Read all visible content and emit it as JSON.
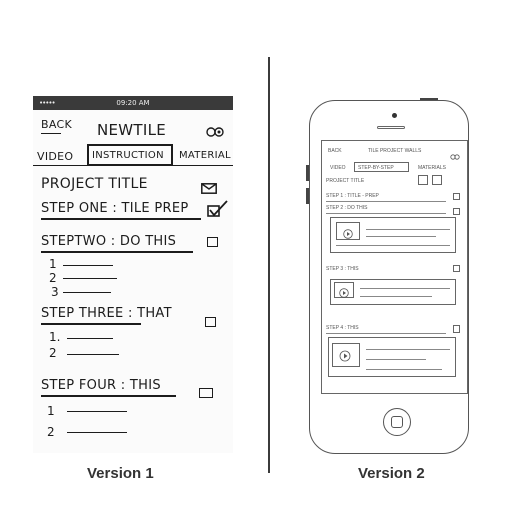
{
  "captions": {
    "version1": "Version 1",
    "version2": "Version 2"
  },
  "v1": {
    "status_time": "09:20 AM",
    "status_dots": "•••••",
    "back_label": "BACK",
    "title": "NEWTILE",
    "tabs": [
      "VIDEO",
      "INSTRUCTION",
      "MATERIAL"
    ],
    "project_title": "PROJECT TITLE",
    "steps": [
      {
        "label": "STEP ONE : TILE PREP",
        "checked": true
      },
      {
        "label": "STEPTWO : DO THIS",
        "checked": false,
        "items": [
          "1",
          "2",
          "3"
        ]
      },
      {
        "label": "STEP THREE : THAT",
        "checked": false,
        "items": [
          "1.",
          "2"
        ]
      },
      {
        "label": "STEP FOUR : THIS",
        "checked": false,
        "items": [
          "1",
          "2"
        ]
      }
    ]
  },
  "v2": {
    "back_label": "BACK",
    "title": "TILE PROJECT WALLS",
    "tabs": [
      "VIDEO",
      "STEP-BY-STEP",
      "MATERIALS"
    ],
    "project_title": "PROJECT TITLE",
    "rows": [
      "STEP 1 : TITLE - PREP",
      "STEP 2 : DO THIS",
      "STEP 3 : THIS",
      "STEP 4 : THIS"
    ]
  },
  "colors": {
    "ink": "#1c1c1c",
    "divider": "#3b3b3b",
    "phone_outline": "#555555"
  }
}
